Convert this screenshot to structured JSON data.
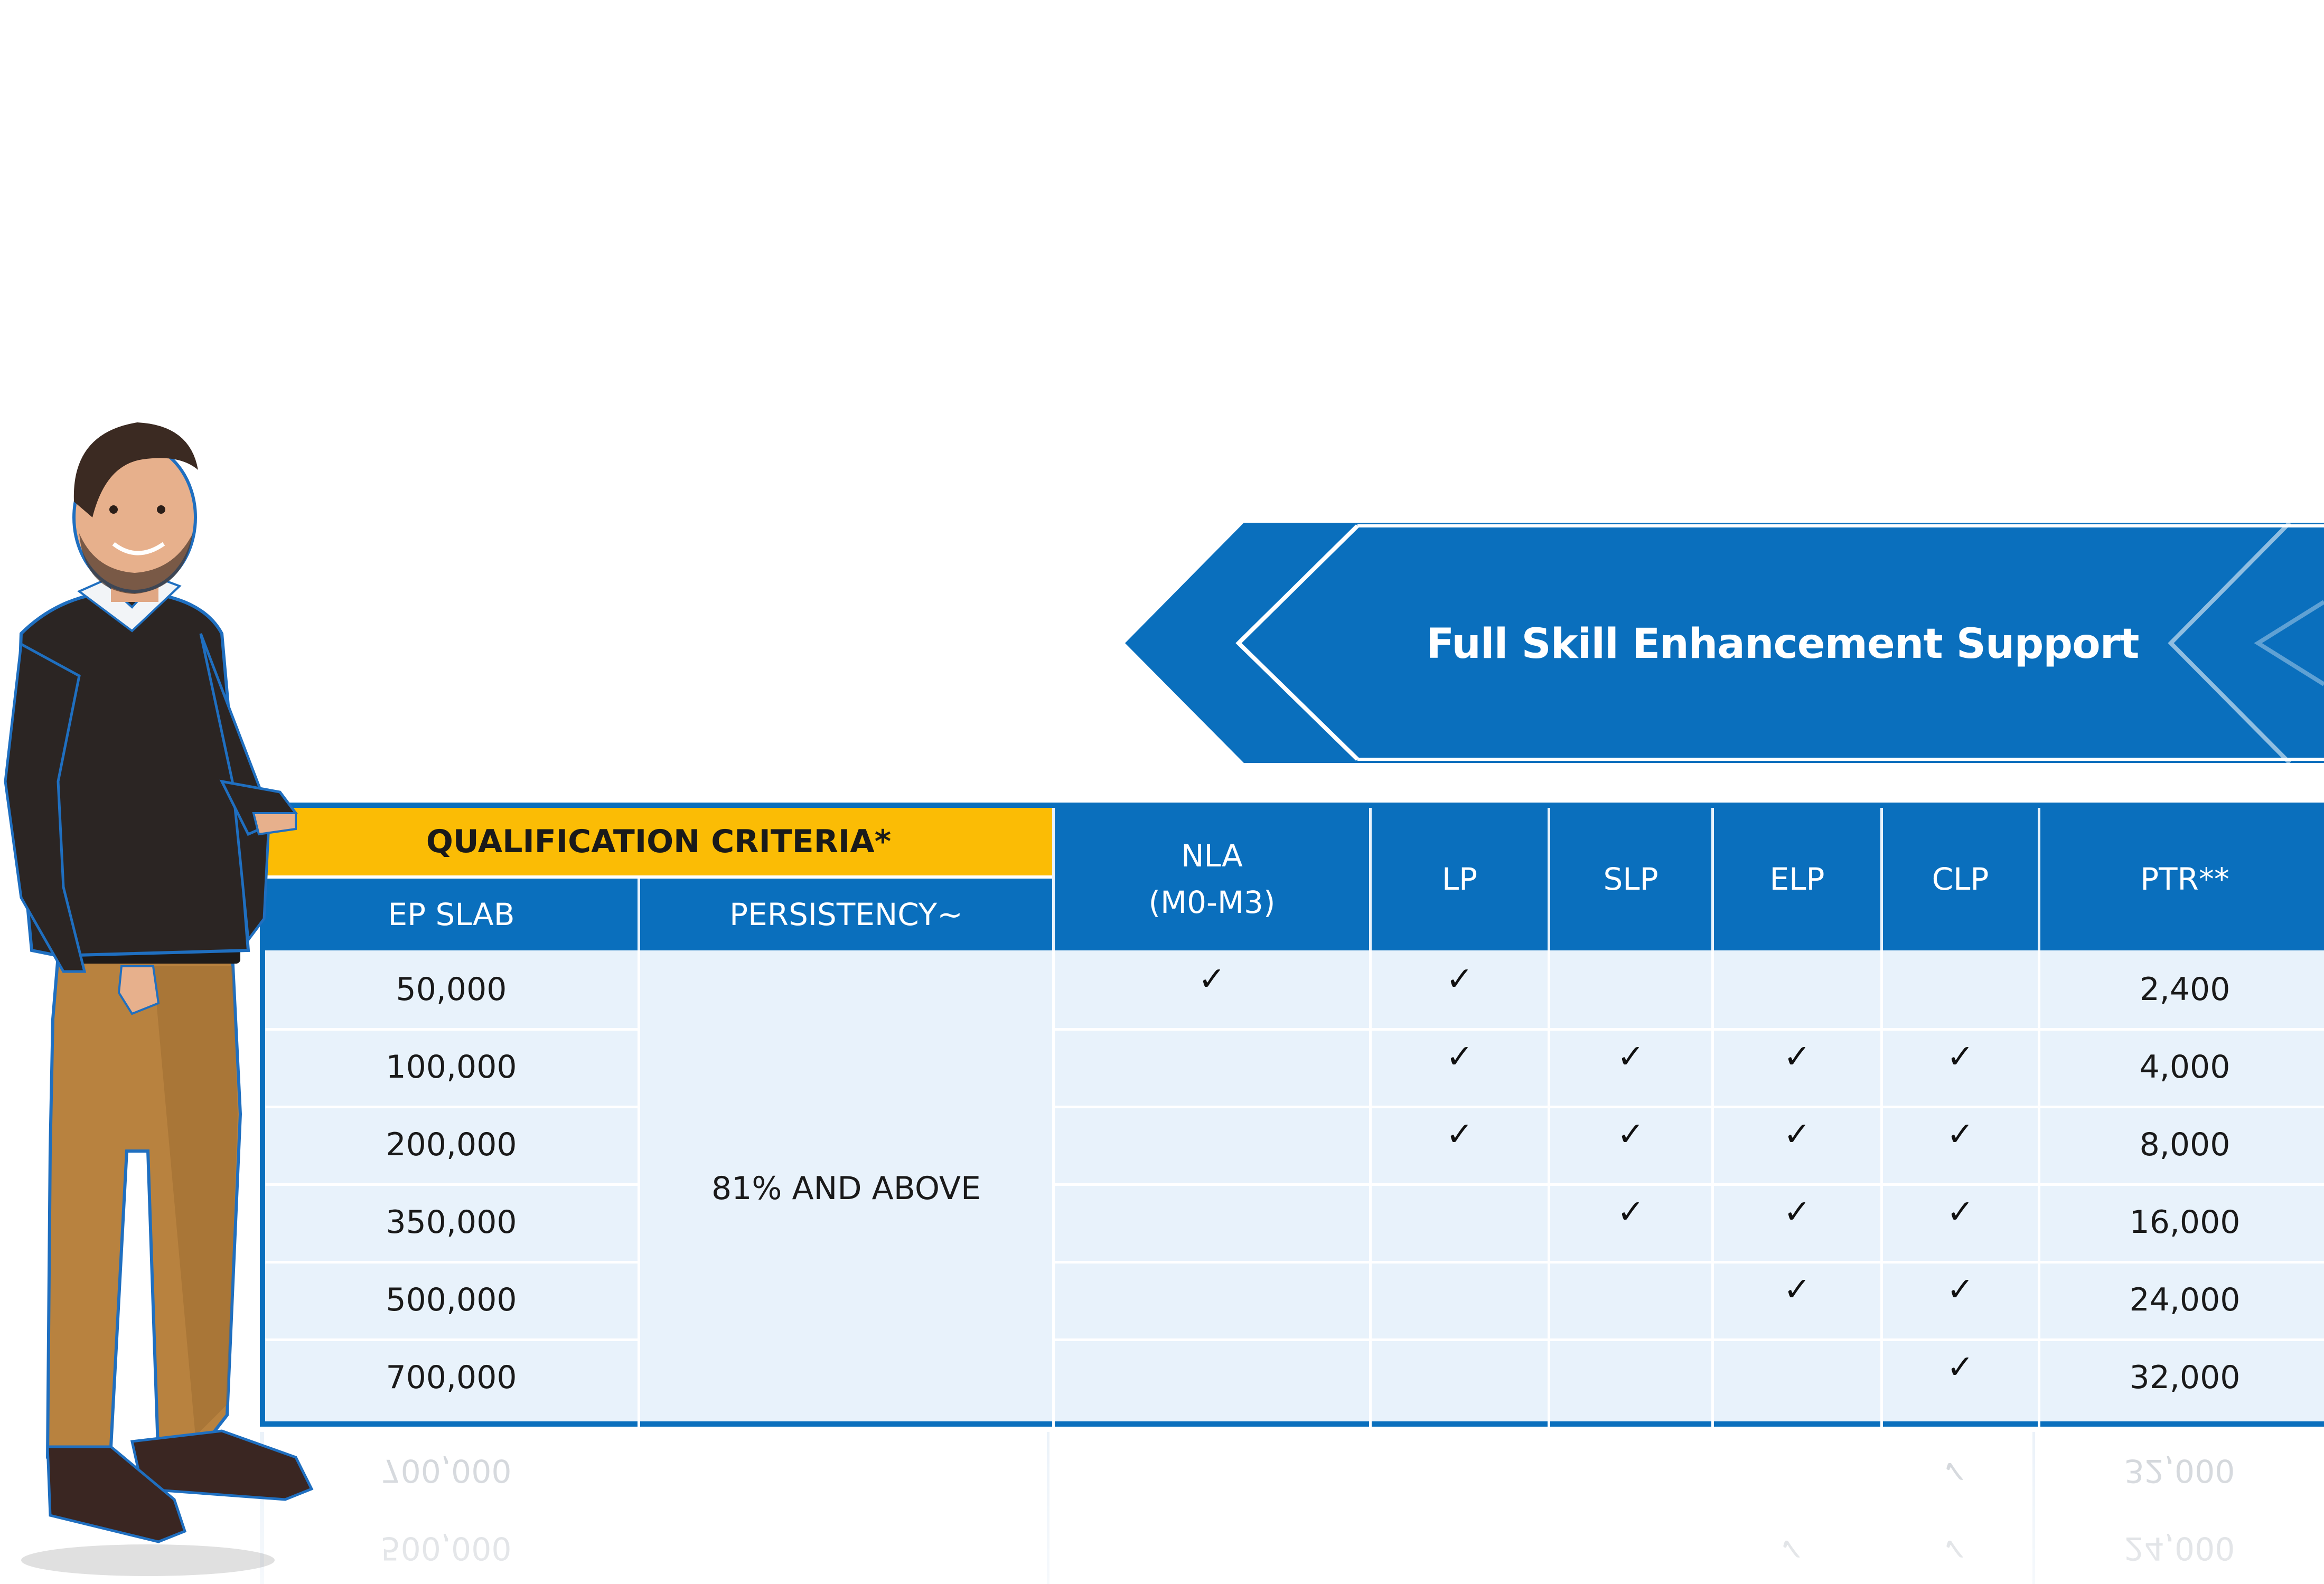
{
  "banner": {
    "title": "Full Skill Enhancement Support",
    "color": "#0a6fbd"
  },
  "table": {
    "group_header": "QUALIFICATION CRITERIA*",
    "group_header_color": "#fbbc05",
    "header_color": "#0a6fbd",
    "columns": {
      "ep_slab": "EP SLAB",
      "persistency": "PERSISTENCY~",
      "nla_line1": "NLA",
      "nla_line2": "(M0-M3)",
      "lp": "LP",
      "slp": "SLP",
      "elp": "ELP",
      "clp": "CLP",
      "ptr": "PTR**"
    },
    "persistency_value": "81% AND ABOVE",
    "check_glyph": "✓",
    "rows": [
      {
        "ep_slab": "50,000",
        "nla": true,
        "lp": true,
        "slp": false,
        "elp": false,
        "clp": false,
        "ptr": "2,400"
      },
      {
        "ep_slab": "100,000",
        "nla": false,
        "lp": true,
        "slp": true,
        "elp": true,
        "clp": true,
        "ptr": "4,000"
      },
      {
        "ep_slab": "200,000",
        "nla": false,
        "lp": true,
        "slp": true,
        "elp": true,
        "clp": true,
        "ptr": "8,000"
      },
      {
        "ep_slab": "350,000",
        "nla": false,
        "lp": false,
        "slp": true,
        "elp": true,
        "clp": true,
        "ptr": "16,000"
      },
      {
        "ep_slab": "500,000",
        "nla": false,
        "lp": false,
        "slp": false,
        "elp": true,
        "clp": true,
        "ptr": "24,000"
      },
      {
        "ep_slab": "700,000",
        "nla": false,
        "lp": false,
        "slp": false,
        "elp": false,
        "clp": true,
        "ptr": "32,000"
      }
    ]
  },
  "person": {
    "icon": "person-illustration"
  }
}
